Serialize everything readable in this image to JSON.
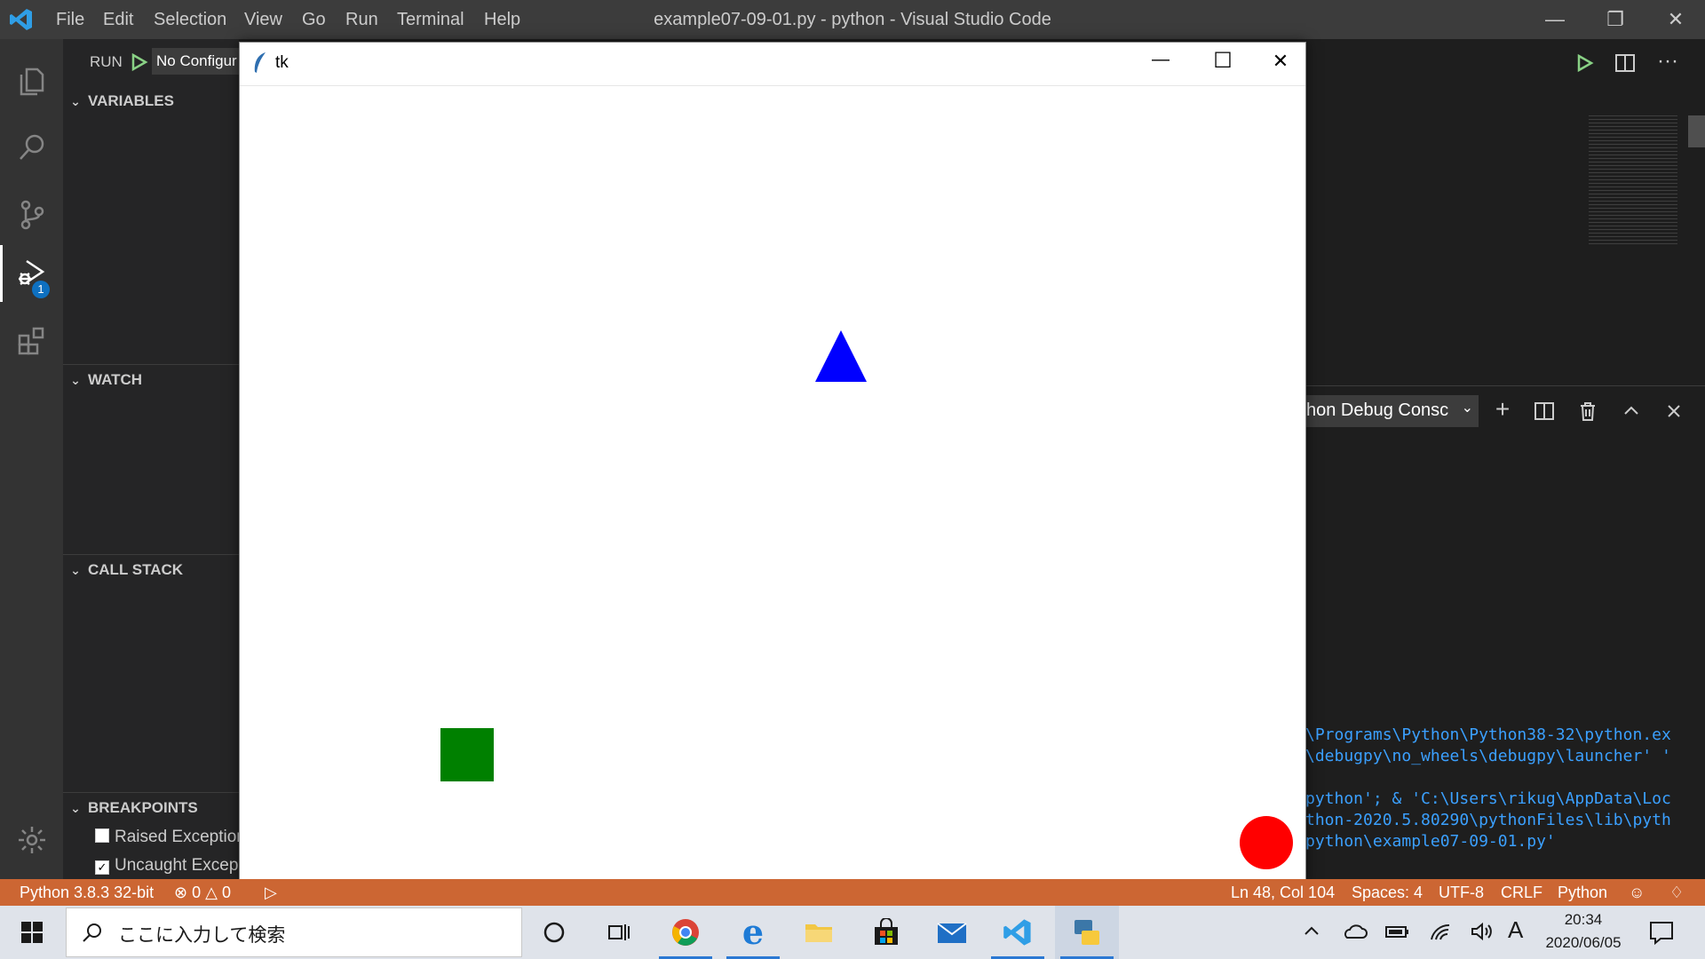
{
  "titlebar": {
    "menus": [
      "File",
      "Edit",
      "Selection",
      "View",
      "Go",
      "Run",
      "Terminal",
      "Help"
    ],
    "window_title": "example07-09-01.py - python - Visual Studio Code",
    "minimize": "—",
    "restore": "❐",
    "close": "✕"
  },
  "activity": {
    "debug_badge": "1"
  },
  "sidebar": {
    "run_label": "RUN",
    "config": "No Configur",
    "variables": "VARIABLES",
    "watch": "WATCH",
    "call_stack": "CALL STACK",
    "breakpoints": "BREAKPOINTS",
    "bp_items": [
      {
        "label": "Raised Exception",
        "checked": false
      },
      {
        "label": "Uncaught Excep",
        "checked": true
      }
    ]
  },
  "tk": {
    "title": "tk",
    "minimize": "—",
    "maximize": "☐",
    "close": "✕",
    "colors": {
      "triangle": "#0000ff",
      "square": "#008000",
      "circle": "#ff0000"
    }
  },
  "panel": {
    "console_select": "hon Debug Consc",
    "lines": [
      "\\Programs\\Python\\Python38-32\\python.ex",
      "\\debugpy\\no_wheels\\debugpy\\launcher' '",
      "",
      "python'; & 'C:\\Users\\rikug\\AppData\\Loc",
      "thon-2020.5.80290\\pythonFiles\\lib\\pyth",
      "python\\example07-09-01.py'"
    ]
  },
  "status": {
    "interpreter": "Python 3.8.3 32-bit",
    "errors": "0",
    "warnings": "0",
    "position": "Ln 48, Col 104",
    "spaces": "Spaces: 4",
    "encoding": "UTF-8",
    "eol": "CRLF",
    "language": "Python"
  },
  "taskbar": {
    "search_placeholder": "ここに入力して検索",
    "time": "20:34",
    "date": "2020/06/05",
    "ime": "A"
  }
}
